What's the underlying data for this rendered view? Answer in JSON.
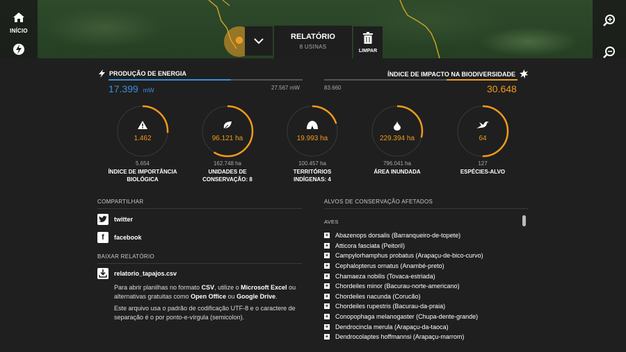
{
  "nav": {
    "home_label": "INÍCIO",
    "report_title": "RELATÓRIO",
    "report_subtitle": "8 USINAS",
    "clear_label": "LIMPAR"
  },
  "energy": {
    "title": "PRODUÇÃO DE ENERGIA",
    "value": "17.399",
    "unit": "mW",
    "max": "27.567 mW",
    "fraction": 0.631,
    "color": "#3a8fe0"
  },
  "biodiversity": {
    "title": "ÍNDICE DE IMPACTO NA BIODIVERSIDADE",
    "min": "83.660",
    "value": "30.648",
    "fraction": 0.366,
    "color": "#f39a1c"
  },
  "gauges": [
    {
      "icon": "warning-icon",
      "value": "1.462",
      "max": "5.654",
      "caption1": "ÍNDICE DE IMPORTÂNCIA",
      "caption2": "BIOLÓGICA",
      "fraction": 0.26
    },
    {
      "icon": "leaf-icon",
      "value": "96.121 ha",
      "max": "162.748 ha",
      "caption1": "UNIDADES DE",
      "caption2": "CONSERVAÇÃO: 8",
      "fraction": 0.59
    },
    {
      "icon": "tent-icon",
      "value": "19.993 ha",
      "max": "100.457 ha",
      "caption1": "TERRITÓRIOS",
      "caption2": "INDÍGENAS: 4",
      "fraction": 0.2
    },
    {
      "icon": "drop-icon",
      "value": "229.394 ha",
      "max": "796.041 ha",
      "caption1": "ÁREA INUNDADA",
      "caption2": "",
      "fraction": 0.29
    },
    {
      "icon": "bird-icon",
      "value": "64",
      "max": "127",
      "caption1": "ESPÉCIES-ALVO",
      "caption2": "",
      "fraction": 0.5
    }
  ],
  "share": {
    "heading": "COMPARTILHAR",
    "twitter": "twitter",
    "facebook": "facebook"
  },
  "download": {
    "heading": "BAIXAR RELATÓRIO",
    "file": "relatorio_tapajos.csv",
    "p1_a": "Para abrir planilhas no formato ",
    "p1_csv": "CSV",
    "p1_b": ", utilize o ",
    "p1_excel": "Microsoft Excel",
    "p1_c": " ou alternativas gratuitas como ",
    "p1_oo": "Open Office",
    "p1_d": " ou ",
    "p1_gd": "Google Drive",
    "p1_e": ".",
    "p2": "Este arquivo usa o padrão de codificação UTF-8 e o caractere de separação é o por ponto-e-vírgula (semicolon)."
  },
  "targets": {
    "heading": "ALVOS DE CONSERVAÇÃO AFETADOS",
    "group": "AVES",
    "species": [
      "Abazenops dorsalis (Barranqueiro-de-topete)",
      "Atticora fasciata (Peitoril)",
      "Campylorhamphus probatus (Arapaçu-de-bico-curvo)",
      "Cephalopterus ornatus (Anambé-preto)",
      "Chamaeza nobilis (Tovaca-estriada)",
      "Chordeiles minor (Bacurau-norte-americano)",
      "Chordeiles nacunda (Corucão)",
      "Chordeiles rupestris (Bacurau-da-praia)",
      "Conopophaga melanogaster (Chupa-dente-grande)",
      "Dendrocincla merula (Arapaçu-da-taoca)",
      "Dendrocolaptes hoffmannsi (Arapaçu-marrom)"
    ]
  }
}
